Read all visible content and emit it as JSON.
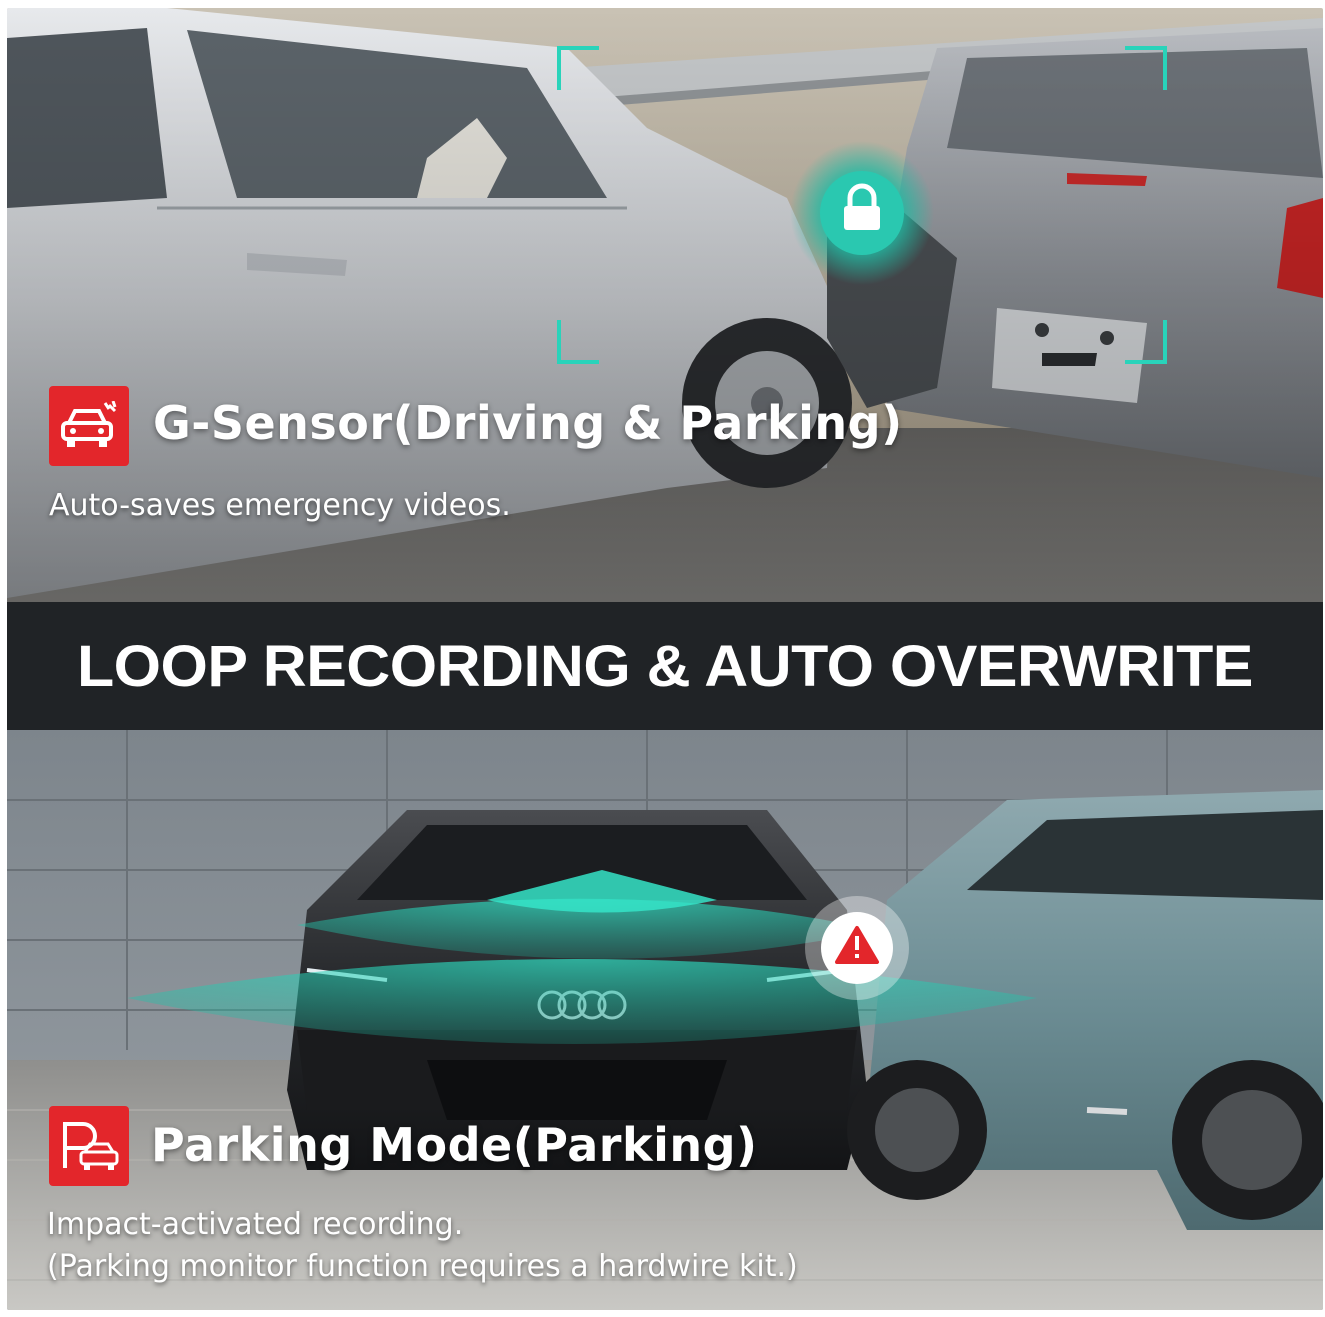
{
  "top_feature": {
    "title": "G-Sensor(Driving & Parking)",
    "description": "Auto-saves emergency videos.",
    "icon": "car-crash-icon",
    "overlay_icon": "lock-icon"
  },
  "banner": {
    "text": "LOOP RECORDING & AUTO OVERWRITE"
  },
  "bottom_feature": {
    "title": "Parking Mode(Parking)",
    "description_lines": [
      "Impact-activated recording.",
      "(Parking monitor function requires a hardwire kit.)"
    ],
    "icon": "parking-car-icon",
    "overlay_icon": "warning-icon"
  },
  "colors": {
    "accent_red": "#e3262b",
    "accent_teal": "#2fd1b8",
    "banner_bg": "#202326"
  }
}
